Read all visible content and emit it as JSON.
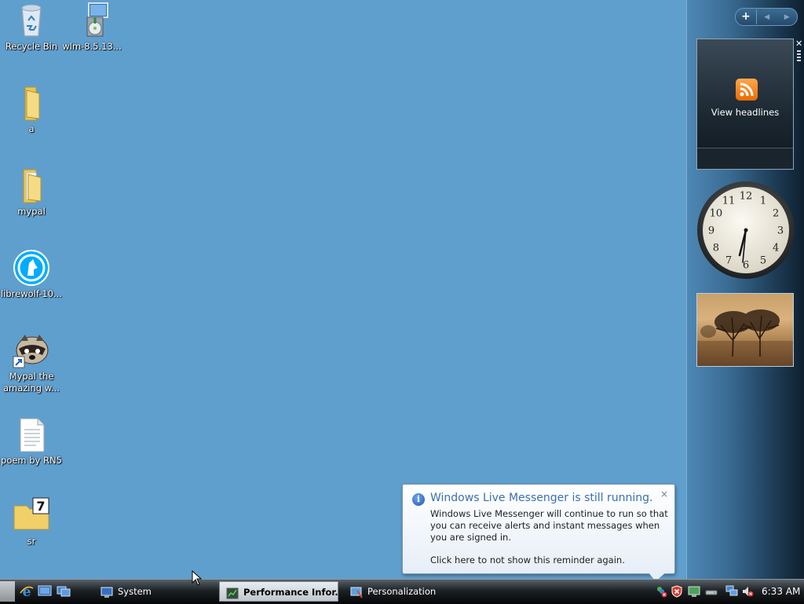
{
  "desktop": {
    "icons": [
      {
        "label": "Recycle Bin",
        "icon": "recycle-bin-icon"
      },
      {
        "label": "wlm-8.5.13...",
        "icon": "installer-icon"
      },
      {
        "label": "a",
        "icon": "folder-icon"
      },
      {
        "label": "mypal",
        "icon": "folder-icon"
      },
      {
        "label": "librewolf-10...",
        "icon": "librewolf-icon"
      },
      {
        "label": "Mypal the amazing w...",
        "icon": "mypal-shortcut-icon"
      },
      {
        "label": "poem by RN5",
        "icon": "text-file-icon"
      },
      {
        "label": "sr",
        "icon": "seven-zip-folder-icon"
      }
    ]
  },
  "sidebar": {
    "controls": {
      "add": "+"
    },
    "rss_gadget": {
      "label": "View headlines"
    },
    "clock_numbers": [
      "12",
      "1",
      "2",
      "3",
      "4",
      "5",
      "6",
      "7",
      "8",
      "9",
      "10",
      "11"
    ]
  },
  "balloon": {
    "title": "Windows Live Messenger is still running.",
    "body": "Windows Live Messenger will continue to run so that you can receive alerts and instant messages when you are signed in.",
    "link": "Click here to not show this reminder again.",
    "close": "×"
  },
  "taskbar": {
    "buttons": [
      {
        "label": "System",
        "icon": "system-icon",
        "active": false
      },
      {
        "label": "Performance Infor...",
        "icon": "performance-icon",
        "active": true
      },
      {
        "label": "Personalization",
        "icon": "personalization-icon",
        "active": false
      }
    ],
    "clock": "6:33 AM"
  },
  "colors": {
    "desktop": "#5f9fce",
    "balloon_title": "#3b6fb2"
  }
}
